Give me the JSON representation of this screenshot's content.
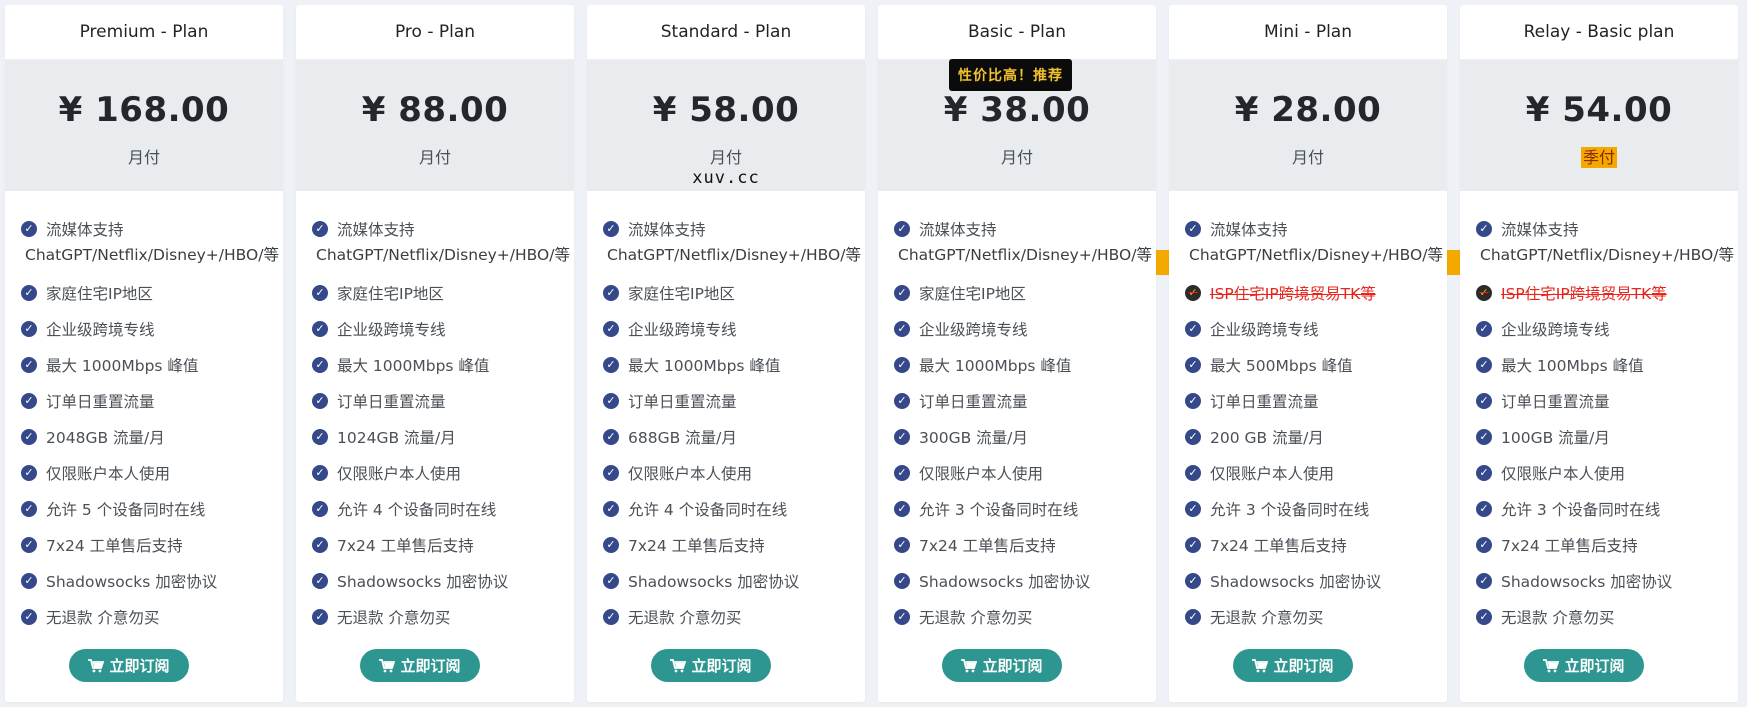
{
  "plans": [
    {
      "name": "Premium - Plan",
      "price": "¥ 168.00",
      "period": "月付",
      "features": [
        "流媒体支持",
        "ChatGPT/Netflix/Disney+/HBO/等",
        "家庭住宅IP地区",
        "企业级跨境专线",
        "最大 1000Mbps 峰值",
        "订单日重置流量",
        "2048GB 流量/月",
        "仅限账户本人使用",
        "允许 5 个设备同时在线",
        "7x24 工单售后支持",
        "Shadowsocks 加密协议",
        "无退款 介意勿买"
      ],
      "button": "立即订阅"
    },
    {
      "name": "Pro - Plan",
      "price": "¥ 88.00",
      "period": "月付",
      "features": [
        "流媒体支持",
        "ChatGPT/Netflix/Disney+/HBO/等",
        "家庭住宅IP地区",
        "企业级跨境专线",
        "最大 1000Mbps 峰值",
        "订单日重置流量",
        "1024GB 流量/月",
        "仅限账户本人使用",
        "允许 4 个设备同时在线",
        "7x24 工单售后支持",
        "Shadowsocks 加密协议",
        "无退款 介意勿买"
      ],
      "button": "立即订阅"
    },
    {
      "name": "Standard - Plan",
      "price": "¥ 58.00",
      "period": "月付",
      "watermark": "xuv.cc",
      "features": [
        "流媒体支持",
        "ChatGPT/Netflix/Disney+/HBO/等",
        "家庭住宅IP地区",
        "企业级跨境专线",
        "最大 1000Mbps 峰值",
        "订单日重置流量",
        "688GB 流量/月",
        "仅限账户本人使用",
        "允许 4 个设备同时在线",
        "7x24 工单售后支持",
        "Shadowsocks 加密协议",
        "无退款 介意勿买"
      ],
      "button": "立即订阅"
    },
    {
      "name": "Basic - Plan",
      "price": "¥ 38.00",
      "period": "月付",
      "badge": "性价比高！推荐",
      "features": [
        "流媒体支持",
        "ChatGPT/Netflix/Disney+/HBO/等",
        "家庭住宅IP地区",
        "企业级跨境专线",
        "最大 1000Mbps 峰值",
        "订单日重置流量",
        "300GB 流量/月",
        "仅限账户本人使用",
        "允许 3 个设备同时在线",
        "7x24 工单售后支持",
        "Shadowsocks 加密协议",
        "无退款 介意勿买"
      ],
      "button": "立即订阅"
    },
    {
      "name": "Mini - Plan",
      "price": "¥ 28.00",
      "period": "月付",
      "features": [
        "流媒体支持",
        "ChatGPT/Netflix/Disney+/HBO/等",
        "ISP住宅IP跨境贸易TK等",
        "企业级跨境专线",
        "最大 500Mbps 峰值",
        "订单日重置流量",
        "200 GB 流量/月",
        "仅限账户本人使用",
        "允许 3 个设备同时在线",
        "7x24 工单售后支持",
        "Shadowsocks 加密协议",
        "无退款 介意勿买"
      ],
      "button": "立即订阅"
    },
    {
      "name": "Relay - Basic plan",
      "price": "¥ 54.00",
      "period": "季付",
      "features": [
        "流媒体支持",
        "ChatGPT/Netflix/Disney+/HBO/等",
        "ISP住宅IP跨境贸易TK等",
        "企业级跨境专线",
        "最大 100Mbps 峰值",
        "订单日重置流量",
        "100GB 流量/月",
        "仅限账户本人使用",
        "允许 3 个设备同时在线",
        "7x24 工单售后支持",
        "Shadowsocks 加密协议",
        "无退款 介意勿买"
      ],
      "button": "立即订阅"
    }
  ],
  "colors": {
    "button": "#2e9690",
    "check": "#35498a",
    "highlight": "#f5a800",
    "strike_text": "#e8251c",
    "badge_bg": "#0b0b0b",
    "badge_text": "#f2c12e"
  },
  "icons": {
    "check": "check-circle-icon",
    "cart": "shopping-cart-icon"
  }
}
